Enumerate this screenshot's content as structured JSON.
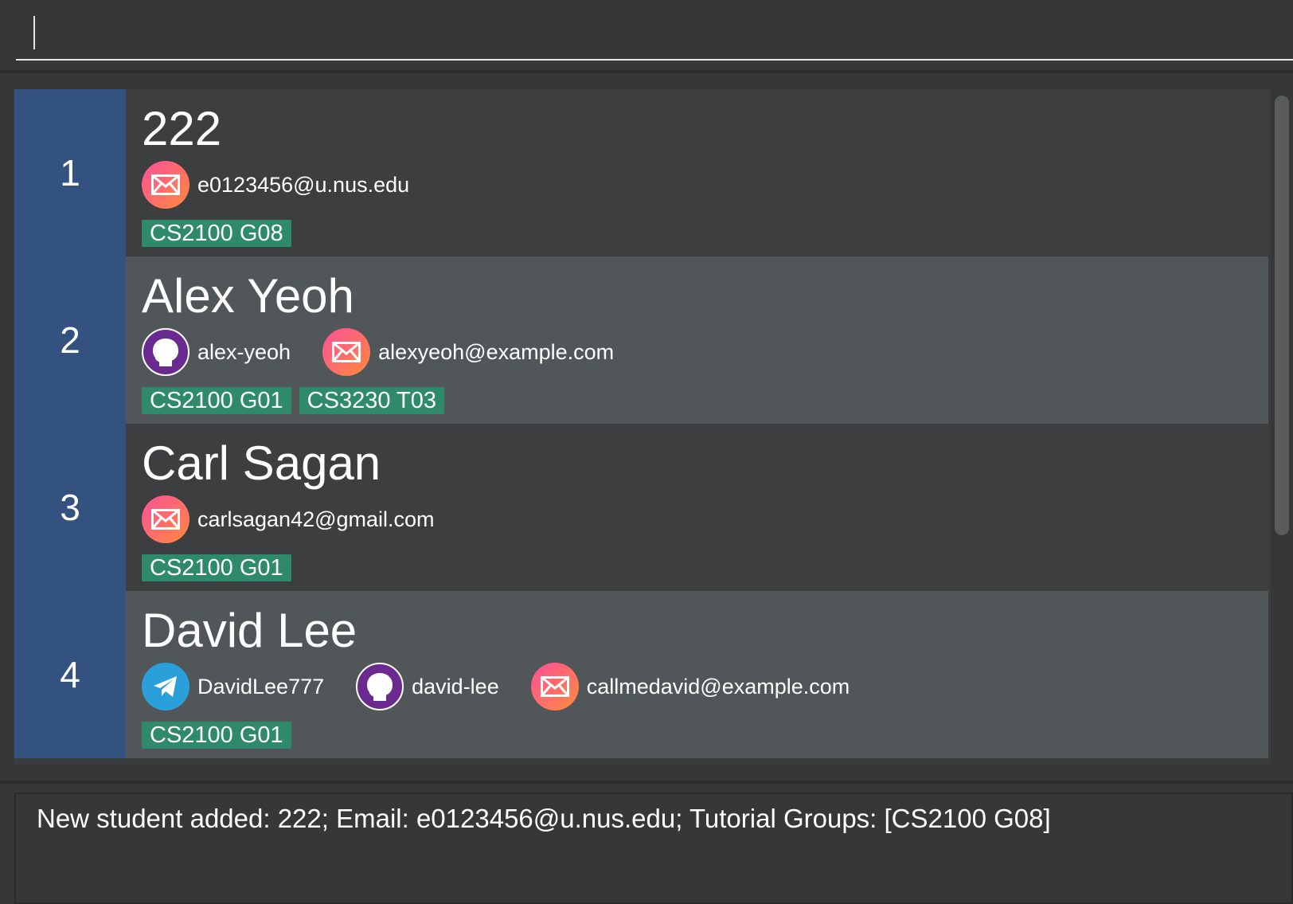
{
  "command_box": {
    "value": "",
    "placeholder": ""
  },
  "students": [
    {
      "index": "1",
      "name": "222",
      "contacts": [
        {
          "type": "email",
          "icon": "email-icon",
          "text": "e0123456@u.nus.edu"
        }
      ],
      "tags": [
        "CS2100 G08"
      ]
    },
    {
      "index": "2",
      "name": "Alex Yeoh",
      "contacts": [
        {
          "type": "github",
          "icon": "github-icon",
          "text": "alex-yeoh"
        },
        {
          "type": "email",
          "icon": "email-icon",
          "text": "alexyeoh@example.com"
        }
      ],
      "tags": [
        "CS2100 G01",
        "CS3230 T03"
      ]
    },
    {
      "index": "3",
      "name": "Carl Sagan",
      "contacts": [
        {
          "type": "email",
          "icon": "email-icon",
          "text": "carlsagan42@gmail.com"
        }
      ],
      "tags": [
        "CS2100 G01"
      ]
    },
    {
      "index": "4",
      "name": "David Lee",
      "contacts": [
        {
          "type": "telegram",
          "icon": "telegram-icon",
          "text": "DavidLee777"
        },
        {
          "type": "github",
          "icon": "github-icon",
          "text": "david-lee"
        },
        {
          "type": "email",
          "icon": "email-icon",
          "text": "callmedavid@example.com"
        }
      ],
      "tags": [
        "CS2100 G01"
      ]
    }
  ],
  "result_display": {
    "text": "New student added: 222; Email: e0123456@u.nus.edu; Tutorial Groups: [CS2100 G08]"
  },
  "colors": {
    "background": "#373737",
    "index_cell": "#34527f",
    "tag": "#2e8a6a",
    "card_odd": "#3d3e3f",
    "card_even": "#515658"
  }
}
